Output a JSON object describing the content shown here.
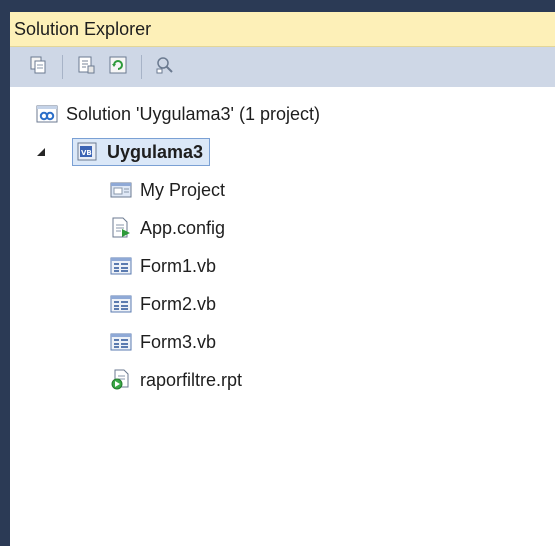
{
  "panel": {
    "title": "Solution Explorer"
  },
  "toolbar": {
    "buttons": [
      {
        "icon": "show-all-files-icon"
      },
      {
        "icon": "properties-icon"
      },
      {
        "icon": "refresh-icon"
      },
      {
        "icon": "view-class-diagram-icon"
      }
    ]
  },
  "tree": {
    "solution": {
      "label": "Solution 'Uygulama3' (1 project)",
      "icon": "solution-icon"
    },
    "project": {
      "label": "Uygulama3",
      "icon": "vb-project-icon",
      "expanded": true,
      "selected": true
    },
    "items": [
      {
        "label": "My Project",
        "icon": "my-project-icon"
      },
      {
        "label": "App.config",
        "icon": "config-file-icon"
      },
      {
        "label": "Form1.vb",
        "icon": "form-icon"
      },
      {
        "label": "Form2.vb",
        "icon": "form-icon"
      },
      {
        "label": "Form3.vb",
        "icon": "form-icon"
      },
      {
        "label": "raporfiltre.rpt",
        "icon": "report-icon"
      }
    ]
  },
  "colors": {
    "title_bg": "#fdf0b8",
    "toolbar_bg": "#ced7e6",
    "selection_border": "#7aa0d4",
    "selection_bg": "#dbe8f8"
  }
}
